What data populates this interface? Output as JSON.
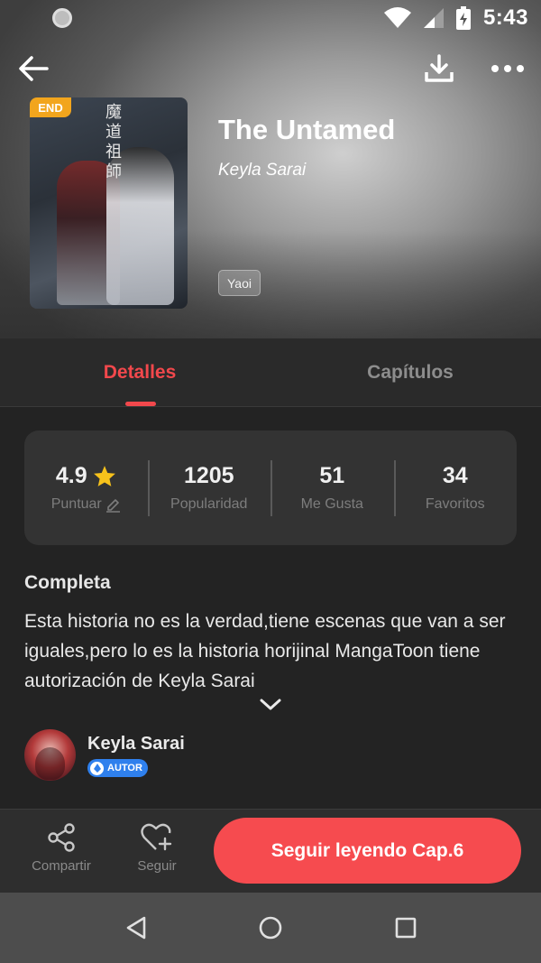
{
  "status_bar": {
    "time": "5:43"
  },
  "book": {
    "badge": "END",
    "title": "The Untamed",
    "author": "Keyla Sarai",
    "genre": "Yaoi",
    "cover_text": "魔道祖師"
  },
  "tabs": [
    {
      "label": "Detalles",
      "active": true
    },
    {
      "label": "Capítulos",
      "active": false
    }
  ],
  "stats": {
    "rating": {
      "value": "4.9",
      "label": "Puntuar"
    },
    "popularity": {
      "value": "1205",
      "label": "Popularidad"
    },
    "likes": {
      "value": "51",
      "label": "Me Gusta"
    },
    "favorites": {
      "value": "34",
      "label": "Favoritos"
    }
  },
  "description": {
    "status": "Completa",
    "text": "Esta historia no es la verdad,tiene escenas que van a ser iguales,pero lo es la historia horijinal MangaToon tiene autorización de Keyla Sarai"
  },
  "author_card": {
    "name": "Keyla Sarai",
    "badge": "AUTOR"
  },
  "actions": {
    "share": "Compartir",
    "follow": "Seguir",
    "read": "Seguir leyendo Cap.6"
  },
  "colors": {
    "accent": "#f2484c",
    "read_button": "#f64b4f",
    "end_badge": "#f2a51d",
    "author_badge": "#2f80ed",
    "star": "#f7c21b"
  },
  "icons": [
    "back-arrow-icon",
    "download-icon",
    "more-icon",
    "star-icon",
    "pencil-icon",
    "chevron-down-icon",
    "share-icon",
    "heart-plus-icon",
    "nav-back-icon",
    "nav-home-icon",
    "nav-recent-icon"
  ]
}
